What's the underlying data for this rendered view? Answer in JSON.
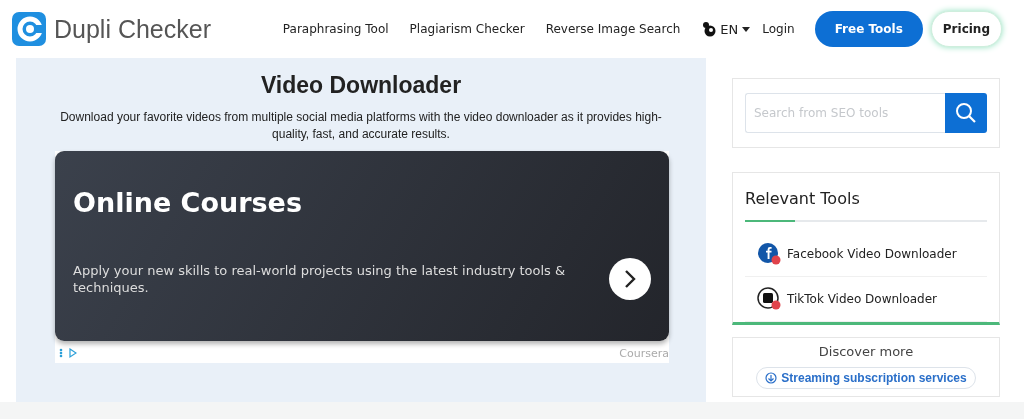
{
  "logo": {
    "text": "Dupli Checker"
  },
  "nav": [
    "Paraphrasing Tool",
    "Plagiarism Checker",
    "Reverse Image Search"
  ],
  "language": "EN",
  "login": "Login",
  "buttons": [
    {
      "label": "Free Tools",
      "kind": "primary"
    },
    {
      "label": "Pricing",
      "kind": "outline"
    }
  ],
  "main": {
    "title": "Video Downloader",
    "description": "Download your favorite videos from multiple social media platforms with the video downloader as it provides high-quality, fast, and accurate results."
  },
  "ad": {
    "headline": "Online Courses",
    "body": "Apply your new skills to real-world projects using the latest industry tools & techniques.",
    "sponsor": "Coursera"
  },
  "search": {
    "placeholder": "Search from SEO tools"
  },
  "relevant_tools": {
    "title": "Relevant Tools",
    "items": [
      {
        "label": "Facebook Video Downloader",
        "kind": "facebook"
      },
      {
        "label": "TikTok Video Downloader",
        "kind": "tiktok"
      }
    ]
  },
  "discover": {
    "title": "Discover more",
    "link": "Streaming subscription services"
  }
}
